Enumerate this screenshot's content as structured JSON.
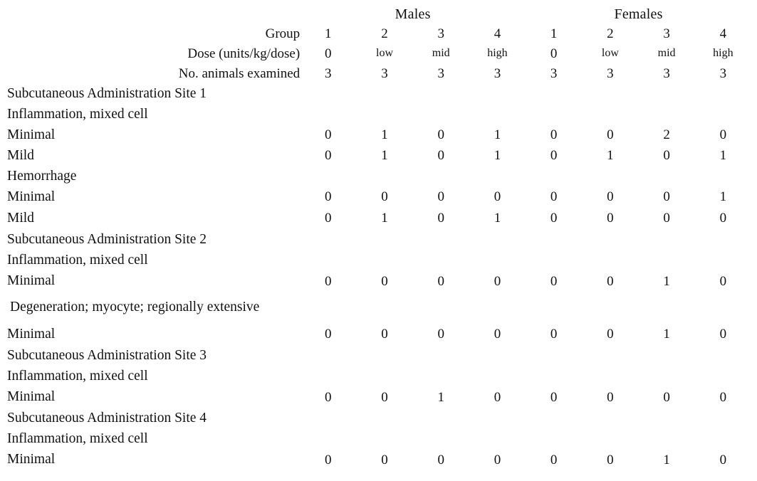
{
  "table": {
    "sex_groups": [
      {
        "label": "Males"
      },
      {
        "label": "Females"
      }
    ],
    "row_headers": [
      {
        "label": "Group"
      },
      {
        "label": "Dose  (units/kg/dose)"
      },
      {
        "label": "No. animals examined"
      }
    ],
    "header_rows": {
      "group": {
        "label": "Group",
        "males": [
          "1",
          "2",
          "3",
          "4"
        ],
        "females": [
          "1",
          "2",
          "3",
          "4"
        ]
      },
      "dose": {
        "label": "Dose  (units/kg/dose)",
        "males": [
          "0",
          "low",
          "mid",
          "high"
        ],
        "females": [
          "0",
          "low",
          "mid",
          "high"
        ]
      },
      "animals": {
        "label": "No. animals examined",
        "males": [
          "3",
          "3",
          "3",
          "3"
        ],
        "females": [
          "3",
          "3",
          "3",
          "3"
        ]
      }
    },
    "sections": [
      {
        "title": "Subcutaneous Administration Site 1",
        "findings": [
          {
            "name": "Inflammation, mixed cell",
            "grades": [
              {
                "label": "Minimal",
                "males": [
                  "0",
                  "1",
                  "0",
                  "1"
                ],
                "females": [
                  "0",
                  "0",
                  "2",
                  "0"
                ]
              },
              {
                "label": "Mild",
                "males": [
                  "0",
                  "1",
                  "0",
                  "1"
                ],
                "females": [
                  "0",
                  "1",
                  "0",
                  "1"
                ]
              }
            ]
          },
          {
            "name": "Hemorrhage",
            "grades": [
              {
                "label": "Minimal",
                "males": [
                  "0",
                  "0",
                  "0",
                  "0"
                ],
                "females": [
                  "0",
                  "0",
                  "0",
                  "1"
                ]
              },
              {
                "label": "Mild",
                "males": [
                  "0",
                  "1",
                  "0",
                  "1"
                ],
                "females": [
                  "0",
                  "0",
                  "0",
                  "0"
                ]
              }
            ]
          }
        ]
      },
      {
        "title": "Subcutaneous Administration Site 2",
        "findings": [
          {
            "name": "Inflammation, mixed cell",
            "grades": [
              {
                "label": "Minimal",
                "males": [
                  "0",
                  "0",
                  "0",
                  "0"
                ],
                "females": [
                  "0",
                  "0",
                  "1",
                  "0"
                ]
              }
            ]
          },
          {
            "name": "Degeneration; myocyte; regionally extensive",
            "grades": [
              {
                "label": "Minimal",
                "males": [
                  "0",
                  "0",
                  "0",
                  "0"
                ],
                "females": [
                  "0",
                  "0",
                  "1",
                  "0"
                ]
              }
            ]
          }
        ]
      },
      {
        "title": "Subcutaneous Administration Site 3",
        "findings": [
          {
            "name": "Inflammation, mixed cell",
            "grades": [
              {
                "label": "Minimal",
                "males": [
                  "0",
                  "0",
                  "1",
                  "0"
                ],
                "females": [
                  "0",
                  "0",
                  "0",
                  "0"
                ]
              }
            ]
          }
        ]
      },
      {
        "title": "Subcutaneous Administration Site 4",
        "findings": [
          {
            "name": "Inflammation, mixed cell",
            "grades": [
              {
                "label": "Minimal",
                "males": [
                  "0",
                  "0",
                  "0",
                  "0"
                ],
                "females": [
                  "0",
                  "0",
                  "1",
                  "0"
                ]
              }
            ]
          }
        ]
      }
    ]
  },
  "style": {
    "text_color": "#111111",
    "rule_color": "#000000",
    "background": "#ffffff"
  }
}
